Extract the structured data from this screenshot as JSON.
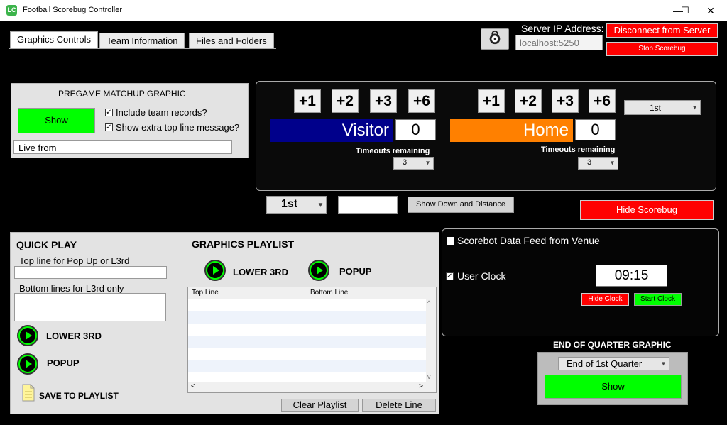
{
  "window": {
    "title": "Football Scorebug Controller",
    "minimize": "—",
    "maximize": "☐",
    "close": "✕",
    "icon_text": "LC"
  },
  "tabs": [
    {
      "label": "Graphics Controls"
    },
    {
      "label": "Team Information"
    },
    {
      "label": "Files and Folders"
    }
  ],
  "server": {
    "ip_label": "Server IP Address:",
    "ip_placeholder": "localhost:5250",
    "disconnect_label": "Disconnect from Server",
    "stop_label": "Stop Scorebug"
  },
  "pregame": {
    "title": "PREGAME MATCHUP GRAPHIC",
    "show_label": "Show",
    "include_records": "Include team records?",
    "extra_message": "Show extra top line message?",
    "message_value": "Live from"
  },
  "score": {
    "visitor": {
      "name": "Visitor",
      "score": "0",
      "color": "#00008b",
      "timeouts": "3"
    },
    "home": {
      "name": "Home",
      "score": "0",
      "color": "#ff8000",
      "timeouts": "3"
    },
    "buttons": [
      "+1",
      "+2",
      "+3",
      "+6"
    ],
    "timeouts_label": "Timeouts remaining",
    "quarter": "1st"
  },
  "down_distance": {
    "down": "1st",
    "distance": "",
    "show_label": "Show Down and Distance",
    "hide_scorebug_label": "Hide Scorebug"
  },
  "quick_play": {
    "title": "QUICK PLAY",
    "top_line_label": "Top line for Pop Up or L3rd",
    "top_line_value": "",
    "bottom_lines_label": "Bottom lines for L3rd only",
    "bottom_lines_value": "",
    "lower3rd_label": "LOWER 3RD",
    "popup_label": "POPUP",
    "save_label": "SAVE TO PLAYLIST"
  },
  "playlist": {
    "title": "GRAPHICS PLAYLIST",
    "lower3rd_label": "LOWER 3RD",
    "popup_label": "POPUP",
    "columns": [
      "Top Line",
      "Bottom Line"
    ],
    "clear_label": "Clear Playlist",
    "delete_label": "Delete Line",
    "scroll_up": "^",
    "scroll_down": "v",
    "scroll_left": "<",
    "scroll_right": ">"
  },
  "feed": {
    "scorebot_label": "Scorebot Data Feed from Venue",
    "scorebot_checked": false,
    "user_clock_label": "User Clock",
    "user_clock_checked": true,
    "clock": "09:15",
    "hide_clock_label": "Hide Clock",
    "start_clock_label": "Start Clock"
  },
  "end_of_quarter": {
    "title": "END OF QUARTER GRAPHIC",
    "selection": "End of 1st Quarter",
    "show_label": "Show"
  }
}
